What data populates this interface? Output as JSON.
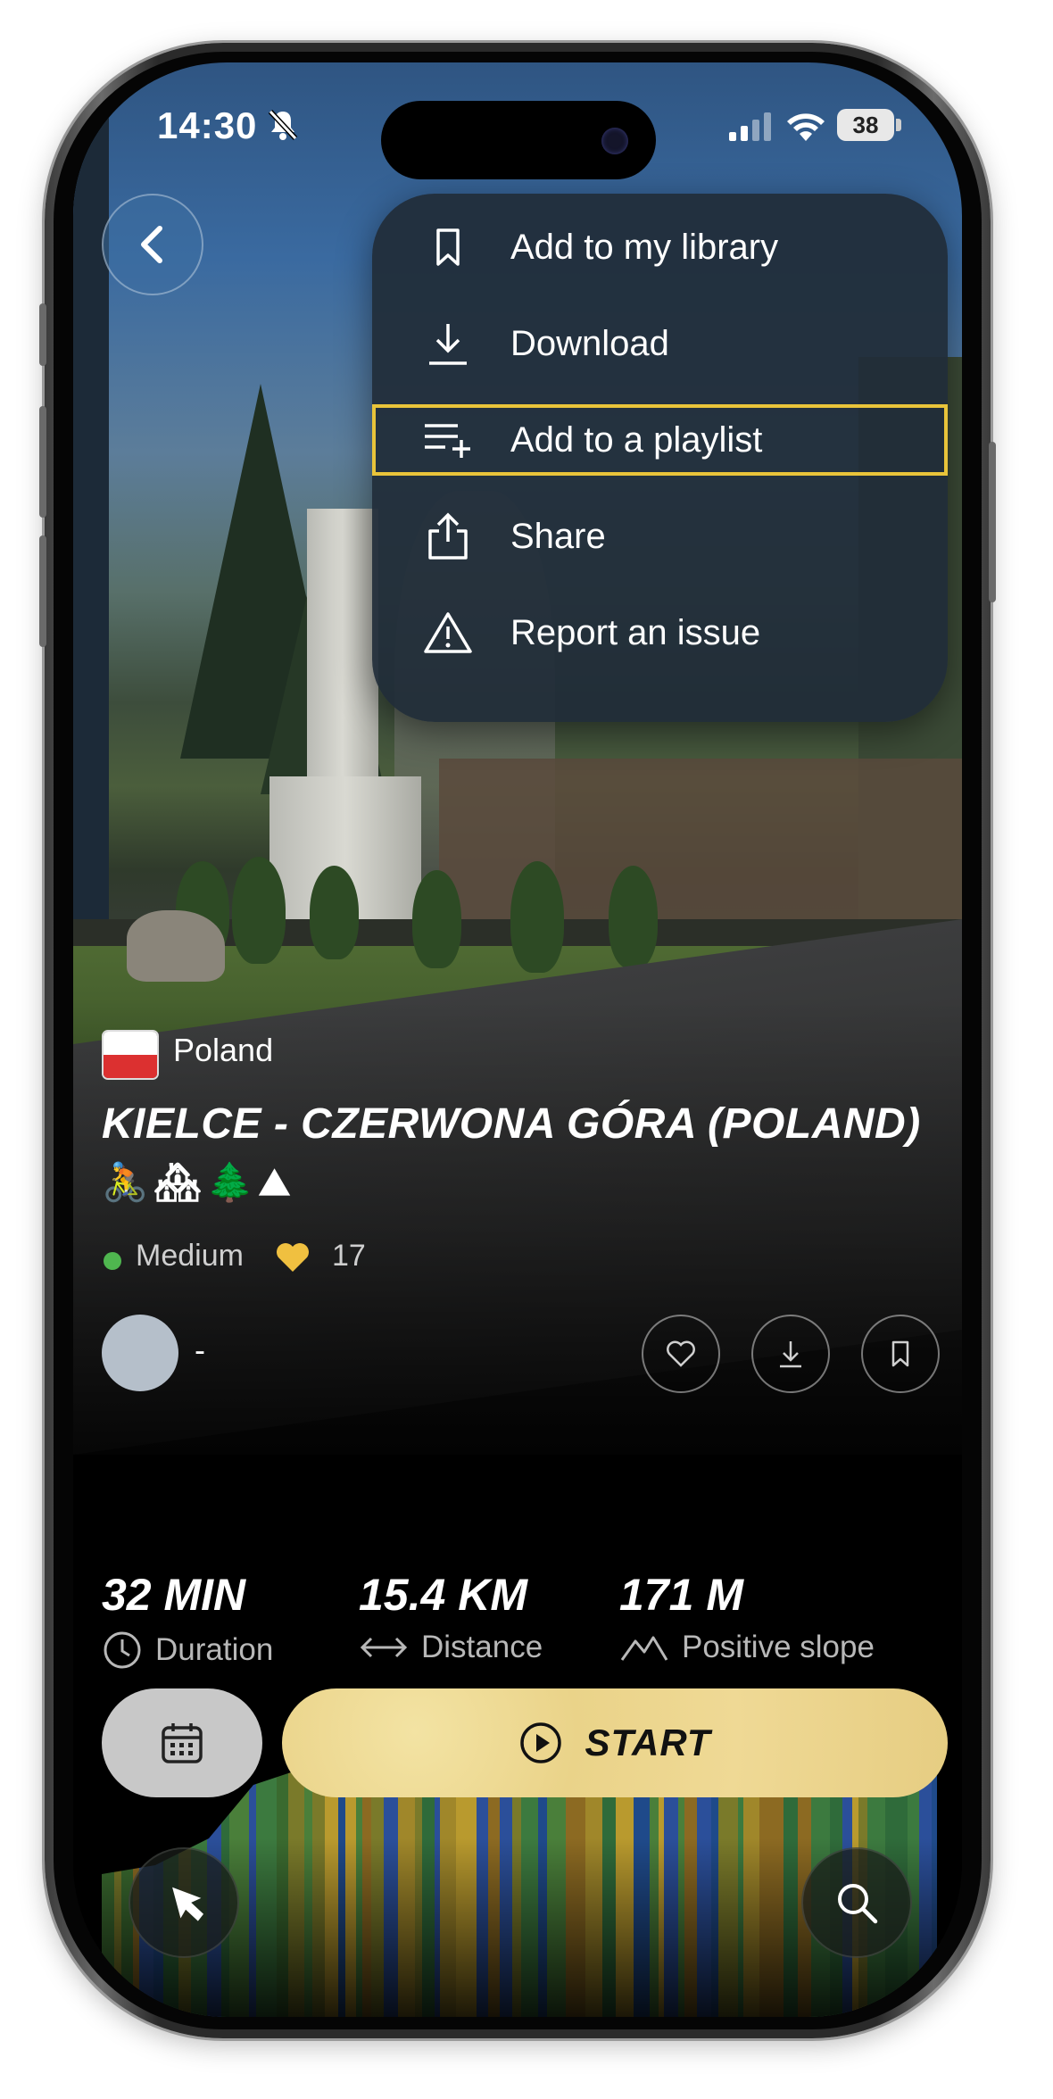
{
  "status_bar": {
    "time": "14:30",
    "battery": "38"
  },
  "menu": {
    "items": [
      {
        "label": "Add to my library",
        "icon": "bookmark-icon"
      },
      {
        "label": "Download",
        "icon": "download-icon"
      },
      {
        "label": "Add to a playlist",
        "icon": "playlist-add-icon",
        "highlighted": true
      },
      {
        "label": "Share",
        "icon": "share-icon"
      },
      {
        "label": "Report an issue",
        "icon": "warning-icon"
      }
    ]
  },
  "route": {
    "country": "Poland",
    "title": "KIELCE - CZERWONA GÓRA (POLAND)",
    "title_emojis": "🚴🏘🌲⛰",
    "difficulty": "Medium",
    "likes": "17",
    "author": "-"
  },
  "stats": [
    {
      "value": "32 MIN",
      "label": "Duration",
      "icon": "clock-icon"
    },
    {
      "value": "15.4 KM",
      "label": "Distance",
      "icon": "distance-arrows-icon"
    },
    {
      "value": "171 M",
      "label": "Positive slope",
      "icon": "mountain-icon"
    }
  ],
  "actions": {
    "start_label": "START"
  },
  "colors": {
    "accent": "#EAD389",
    "highlight": "#E9C43A",
    "difficulty_medium": "#4FB64F"
  }
}
